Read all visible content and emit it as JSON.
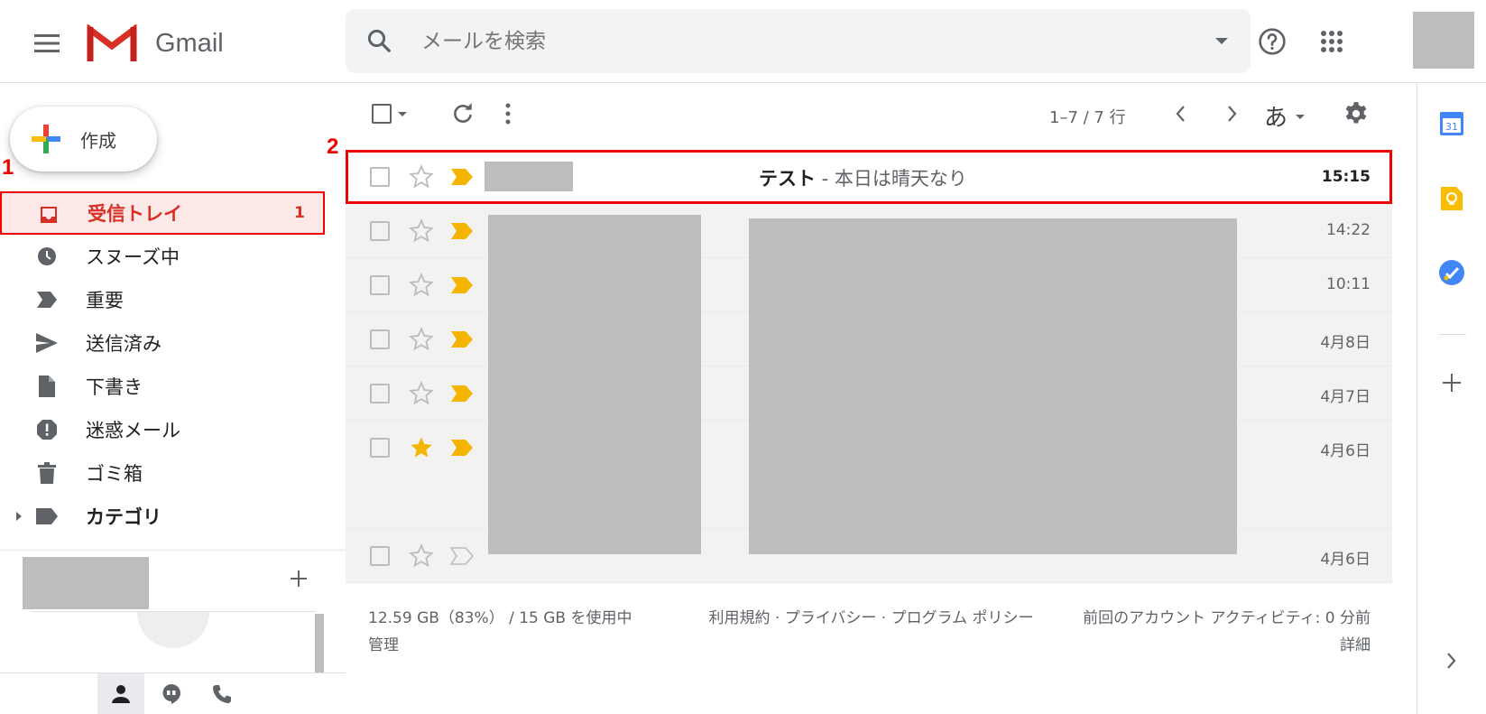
{
  "app": {
    "name": "Gmail"
  },
  "search": {
    "placeholder": "メールを検索"
  },
  "compose": {
    "label": "作成"
  },
  "annotations": {
    "first": "1",
    "second": "2"
  },
  "nav": {
    "items": [
      {
        "id": "inbox",
        "label": "受信トレイ",
        "count": "1",
        "icon": "inbox-icon"
      },
      {
        "id": "snoozed",
        "label": "スヌーズ中",
        "icon": "clock-icon"
      },
      {
        "id": "important",
        "label": "重要",
        "icon": "important-icon"
      },
      {
        "id": "sent",
        "label": "送信済み",
        "icon": "send-icon"
      },
      {
        "id": "drafts",
        "label": "下書き",
        "icon": "draft-icon"
      },
      {
        "id": "spam",
        "label": "迷惑メール",
        "icon": "spam-icon"
      },
      {
        "id": "trash",
        "label": "ゴミ箱",
        "icon": "trash-icon"
      },
      {
        "id": "categories",
        "label": "カテゴリ",
        "icon": "label-icon"
      }
    ]
  },
  "toolbar": {
    "pagination": "1–7 / 7 行",
    "input_mode": "あ"
  },
  "emails": [
    {
      "subject": "テスト",
      "snippet": " - 本日は晴天なり",
      "time": "15:15",
      "unread": true,
      "starred": false
    },
    {
      "time": "14:22",
      "starred": false
    },
    {
      "time": "10:11",
      "starred": false
    },
    {
      "time": "4月8日",
      "starred": false
    },
    {
      "time": "4月7日",
      "starred": false
    },
    {
      "time": "4月6日",
      "starred": true
    },
    {
      "time": "4月6日",
      "starred": false
    }
  ],
  "footer": {
    "storage": "12.59 GB（83%） / 15 GB を使用中",
    "manage": "管理",
    "links": "利用規約 · プライバシー · プログラム ポリシー",
    "activity": "前回のアカウント アクティビティ: 0 分前",
    "details": "詳細"
  },
  "side_panel": {
    "calendar_day": "31"
  },
  "colors": {
    "accent_red": "#d93025",
    "highlight_red": "#ee0000",
    "important_yellow": "#f4b400"
  }
}
